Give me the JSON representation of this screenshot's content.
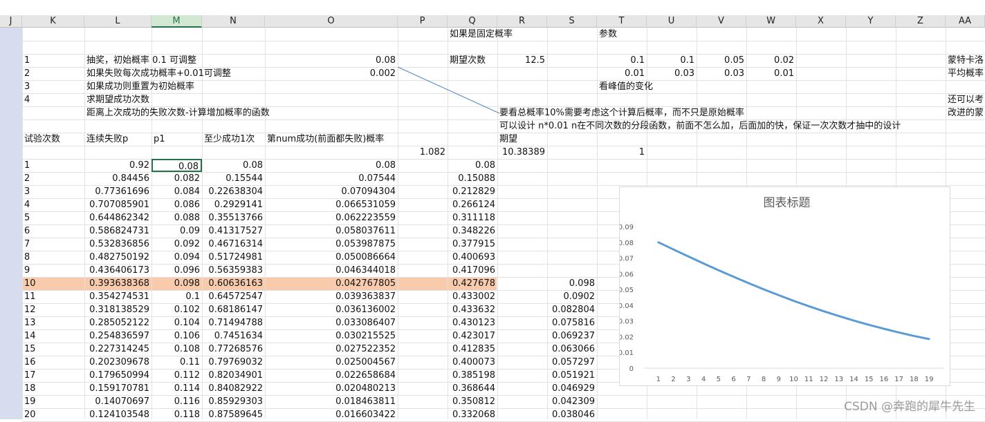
{
  "columns": [
    "J",
    "K",
    "L",
    "M",
    "N",
    "O",
    "P",
    "Q",
    "R",
    "S",
    "T",
    "U",
    "V",
    "W",
    "X",
    "Y",
    "Z",
    "AA"
  ],
  "selected_column": "M",
  "rows": {
    "r0": {
      "Q": "如果是固定概率",
      "T": "参数"
    },
    "r2": {
      "K": "1",
      "L": "抽奖，初始概率 0.1 可调整",
      "O": "0.08",
      "Q": "期望次数",
      "R": "12.5",
      "T": "0.1",
      "U": "0.1",
      "V": "0.05",
      "W": "0.02",
      "AA": "蒙特卡洛"
    },
    "r3": {
      "K": "2",
      "L": "如果失败每次成功概率+0.01可调整",
      "O": "0.002",
      "T": "0.01",
      "U": "0.03",
      "V": "0.03",
      "W": "0.01",
      "AA": "平均概率"
    },
    "r4": {
      "K": "3",
      "L": "如果成功则重置为初始概率",
      "T": "看峰值的变化"
    },
    "r5": {
      "K": "4",
      "L": "求期望成功次数",
      "AA": "还可以考"
    },
    "r6": {
      "L": "距离上次成功的失败次数-计算增加概率的函数",
      "R": "要看总概率10%需要考虑这个计算后概率，而不只是原始概率",
      "AA": "改进的蒙"
    },
    "r7": {
      "R": "可以设计  n*0.01 n在不同次数的分段函数，前面不怎么加，后面加的快，保证一次次数才抽中的设计"
    },
    "r8": {
      "K": "试验次数",
      "L": "连续失败p",
      "M": "p1",
      "N": "至少成功1次",
      "O": "第num成功(前面都失败)概率",
      "R": "期望"
    },
    "r9": {
      "P": "1.082",
      "R": "10.38389",
      "T": "1"
    }
  },
  "table": [
    [
      "1",
      "0.92",
      "0.08",
      "0.08",
      "0.08",
      "0.08",
      ""
    ],
    [
      "2",
      "0.84456",
      "0.082",
      "0.15544",
      "0.07544",
      "0.15088",
      ""
    ],
    [
      "3",
      "0.77361696",
      "0.084",
      "0.22638304",
      "0.07094304",
      "0.212829",
      ""
    ],
    [
      "4",
      "0.707085901",
      "0.086",
      "0.2929141",
      "0.066531059",
      "0.266124",
      ""
    ],
    [
      "5",
      "0.644862342",
      "0.088",
      "0.35513766",
      "0.062223559",
      "0.311118",
      ""
    ],
    [
      "6",
      "0.586824731",
      "0.09",
      "0.41317527",
      "0.058037611",
      "0.348226",
      ""
    ],
    [
      "7",
      "0.532836856",
      "0.092",
      "0.46716314",
      "0.053987875",
      "0.377915",
      ""
    ],
    [
      "8",
      "0.482750192",
      "0.094",
      "0.51724981",
      "0.050086664",
      "0.400693",
      ""
    ],
    [
      "9",
      "0.436406173",
      "0.096",
      "0.56359383",
      "0.046344018",
      "0.417096",
      ""
    ],
    [
      "10",
      "0.393638368",
      "0.098",
      "0.60636163",
      "0.042767805",
      "0.427678",
      "0.098"
    ],
    [
      "11",
      "0.354274531",
      "0.1",
      "0.64572547",
      "0.039363837",
      "0.433002",
      "0.0902"
    ],
    [
      "12",
      "0.318138529",
      "0.102",
      "0.68186147",
      "0.036136002",
      "0.433632",
      "0.082804"
    ],
    [
      "13",
      "0.285052122",
      "0.104",
      "0.71494788",
      "0.033086407",
      "0.430123",
      "0.075816"
    ],
    [
      "14",
      "0.254836597",
      "0.106",
      "0.7451634",
      "0.030215525",
      "0.423017",
      "0.069237"
    ],
    [
      "15",
      "0.227314245",
      "0.108",
      "0.77268576",
      "0.027522352",
      "0.412835",
      "0.063066"
    ],
    [
      "16",
      "0.202309678",
      "0.11",
      "0.79769032",
      "0.025004567",
      "0.400073",
      "0.057297"
    ],
    [
      "17",
      "0.179650994",
      "0.112",
      "0.82034901",
      "0.022658684",
      "0.385198",
      "0.051921"
    ],
    [
      "18",
      "0.159170781",
      "0.114",
      "0.84082922",
      "0.020480213",
      "0.368644",
      "0.046929"
    ],
    [
      "19",
      "0.14070697",
      "0.116",
      "0.85929303",
      "0.018463811",
      "0.350812",
      "0.042309"
    ],
    [
      "20",
      "0.124103548",
      "0.118",
      "0.87589645",
      "0.016603422",
      "0.332068",
      "0.038046"
    ]
  ],
  "highlight_row": 9,
  "highlight_color": "#f8cbad",
  "chart_data": {
    "type": "line",
    "title": "图表标题",
    "categories": [
      "1",
      "2",
      "3",
      "4",
      "5",
      "6",
      "7",
      "8",
      "9",
      "10",
      "11",
      "12",
      "13",
      "14",
      "15",
      "16",
      "17",
      "18",
      "19"
    ],
    "series": [
      {
        "values": [
          0.08,
          0.07544,
          0.07094304,
          0.066531059,
          0.062223559,
          0.058037611,
          0.053987875,
          0.050086664,
          0.046344018,
          0.042767805,
          0.039363837,
          0.036136002,
          0.033086407,
          0.030215525,
          0.027522352,
          0.025004567,
          0.022658684,
          0.020480213,
          0.018463811
        ]
      }
    ],
    "ylim": [
      0,
      0.09
    ],
    "yticks": [
      "0",
      "0.01",
      "0.02",
      "0.03",
      "0.04",
      "0.05",
      "0.06",
      "0.07",
      "0.08",
      "0.09"
    ],
    "line_color": "#5b9bd5",
    "grid": false,
    "legend": "none"
  },
  "watermark": "CSDN @奔跑的犀牛先生"
}
